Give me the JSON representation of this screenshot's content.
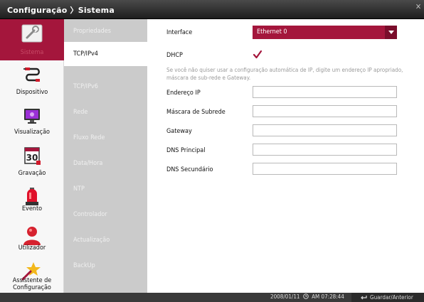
{
  "window": {
    "title": "Configuração 〉Sistema",
    "close_label": "✕"
  },
  "colors": {
    "accent": "#a4163c",
    "subnav_bg": "#cbcbcb"
  },
  "left_nav": [
    {
      "label": "Sistema",
      "icon": "wrench-icon",
      "active": true
    },
    {
      "label": "Dispositivo",
      "icon": "cable-icon",
      "active": false
    },
    {
      "label": "Visualização",
      "icon": "monitor-icon",
      "active": false
    },
    {
      "label": "Gravação",
      "icon": "calendar-icon",
      "active": false,
      "icon_text": "30"
    },
    {
      "label": "Evento",
      "icon": "siren-icon",
      "active": false
    },
    {
      "label": "Utilizador",
      "icon": "user-icon",
      "active": false
    },
    {
      "label": "Assistente de Configuração",
      "icon": "star-wand-icon",
      "active": false
    }
  ],
  "sub_nav": [
    {
      "label": "Propriedades",
      "active": false
    },
    {
      "label": "TCP/IPv4",
      "active": true
    },
    {
      "label": "TCP/IPv6",
      "active": false
    },
    {
      "label": "Rede",
      "active": false
    },
    {
      "label": "Fluxo Rede",
      "active": false
    },
    {
      "label": "Data/Hora",
      "active": false
    },
    {
      "label": "NTP",
      "active": false
    },
    {
      "label": "Controlador",
      "active": false
    },
    {
      "label": "Actualização",
      "active": false
    },
    {
      "label": "BackUp",
      "active": false
    }
  ],
  "form": {
    "interface_label": "Interface",
    "interface_value": "Ethernet 0",
    "dhcp_label": "DHCP",
    "dhcp_checked": true,
    "hint": "Se você não quiser usar a configuração automática de IP, digite um endereço IP apropriado, máscara de sub-rede e Gateway.",
    "fields": [
      {
        "label": "Endereço IP",
        "value": ""
      },
      {
        "label": "Máscara de Subrede",
        "value": ""
      },
      {
        "label": "Gateway",
        "value": ""
      },
      {
        "label": "DNS Principal",
        "value": ""
      },
      {
        "label": "DNS Secundário",
        "value": ""
      }
    ]
  },
  "status": {
    "date": "2008/01/11",
    "time": "AM 07:28:44",
    "save_button": "Guardar/Anterior"
  }
}
